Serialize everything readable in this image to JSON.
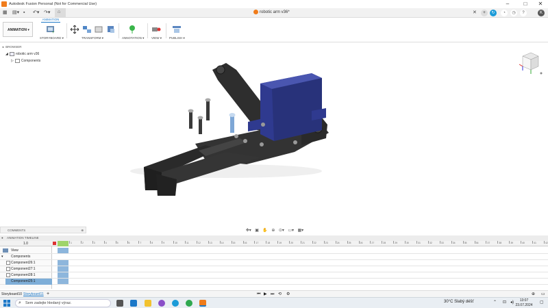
{
  "window": {
    "title": "Autodesk Fusion Personal (Not for Commercial Use)"
  },
  "document": {
    "title": "robotic arm v36*"
  },
  "ribbon": {
    "workspace": "ANIMATION",
    "active_tab": "ANIMATION",
    "groups": [
      {
        "label": "STORYBOARD ▾"
      },
      {
        "label": "TRANSFORM ▾"
      },
      {
        "label": "ANNOTATION ▾"
      },
      {
        "label": "VIEW ▾"
      },
      {
        "label": "PUBLISH ▾"
      }
    ]
  },
  "browser": {
    "header": "BROWSER",
    "root": "robotic arm v36",
    "child": "Components"
  },
  "comments": {
    "label": "COMMENTS"
  },
  "timeline": {
    "header": "ANIMATION TIMELINE",
    "scale": "1.0",
    "rows": [
      {
        "label": "View"
      },
      {
        "label": "Components"
      },
      {
        "label": "Component26:1"
      },
      {
        "label": "Component27:1"
      },
      {
        "label": "Component28:1"
      },
      {
        "label": "Component25:1"
      }
    ],
    "ticks": [
      "1",
      "2",
      "3",
      "4",
      "5",
      "6",
      "7",
      "8",
      "9",
      "10",
      "11",
      "12",
      "13",
      "14",
      "15",
      "16",
      "17",
      "18",
      "19",
      "20",
      "21",
      "22",
      "23",
      "24",
      "25",
      "26",
      "27",
      "28",
      "29",
      "30",
      "31",
      "32",
      "33",
      "34",
      "35",
      "36",
      "37",
      "38",
      "39",
      "40",
      "41",
      "42"
    ]
  },
  "storyboard": {
    "tab1": "Storyboard10",
    "tab2": "Storyboard11",
    "add": "+"
  },
  "taskbar": {
    "search_placeholder": "Sem zadejte hledaný výraz.",
    "weather": "30°C  Slabý déšť",
    "time": "13:07",
    "date": "23.07.2024"
  },
  "colors": {
    "accent": "#1b78c8",
    "fusion_orange": "#f07c1b",
    "servo_blue": "#2f3a8f",
    "part_dark": "#2b2b2b"
  }
}
